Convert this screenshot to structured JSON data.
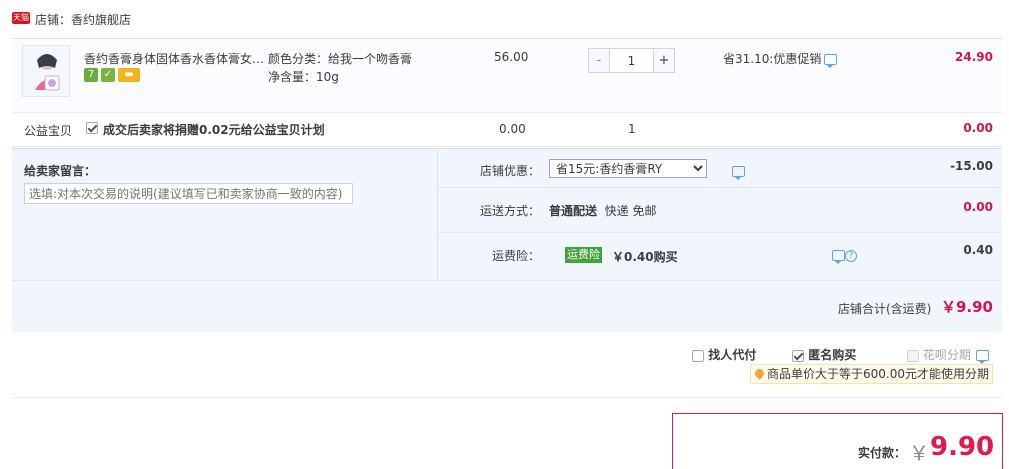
{
  "shop": {
    "label_prefix": "店铺：",
    "name": "香约旗舰店",
    "brand_badge": "天猫"
  },
  "item": {
    "title": "香约香膏身体固体香水香体膏女…",
    "sku_color": "颜色分类：给我一个吻香膏",
    "sku_size": "净含量：10g",
    "badge_7": "7",
    "unit_price": "56.00",
    "quantity": "1",
    "qty_minus": "-",
    "qty_plus": "+",
    "promo_text": "省31.10:优惠促销",
    "subtotal": "24.90"
  },
  "charity": {
    "label": "公益宝贝",
    "checked": true,
    "text": "成交后卖家将捐赠0.02元给公益宝贝计划",
    "price": "0.00",
    "quantity": "1",
    "total": "0.00"
  },
  "message": {
    "title": "给卖家留言：",
    "placeholder": "选填:对本次交易的说明(建议填写已和卖家协商一致的内容)"
  },
  "options": {
    "coupon_label": "店铺优惠：",
    "coupon_selected": "省15元:香约香膏RY",
    "coupon_value": "-15.00",
    "shipping_label": "运送方式：",
    "shipping_method": "普通配送",
    "shipping_detail": "快递 免邮",
    "shipping_value": "0.00",
    "insurance_label": "运费险：",
    "insurance_badge": "运费险",
    "insurance_text": "￥0.40购买",
    "insurance_value": "0.40",
    "shop_total_label": "店铺合计(含运费)",
    "shop_total_value": "￥9.90"
  },
  "bottom": {
    "pay_for_me": "找人代付",
    "anonymous": "匿名购买",
    "installment": "花呗分期",
    "installment_tip": "商品单价大于等于600.00元才能使用分期"
  },
  "total": {
    "label": "实付款：",
    "currency": "￥",
    "value": "9.90"
  },
  "colors": {
    "accent_red": "#e5174f",
    "panel_blue": "#f1f6fd",
    "link_blue": "#5fa1e4",
    "insurance_green": "#43a33b"
  }
}
